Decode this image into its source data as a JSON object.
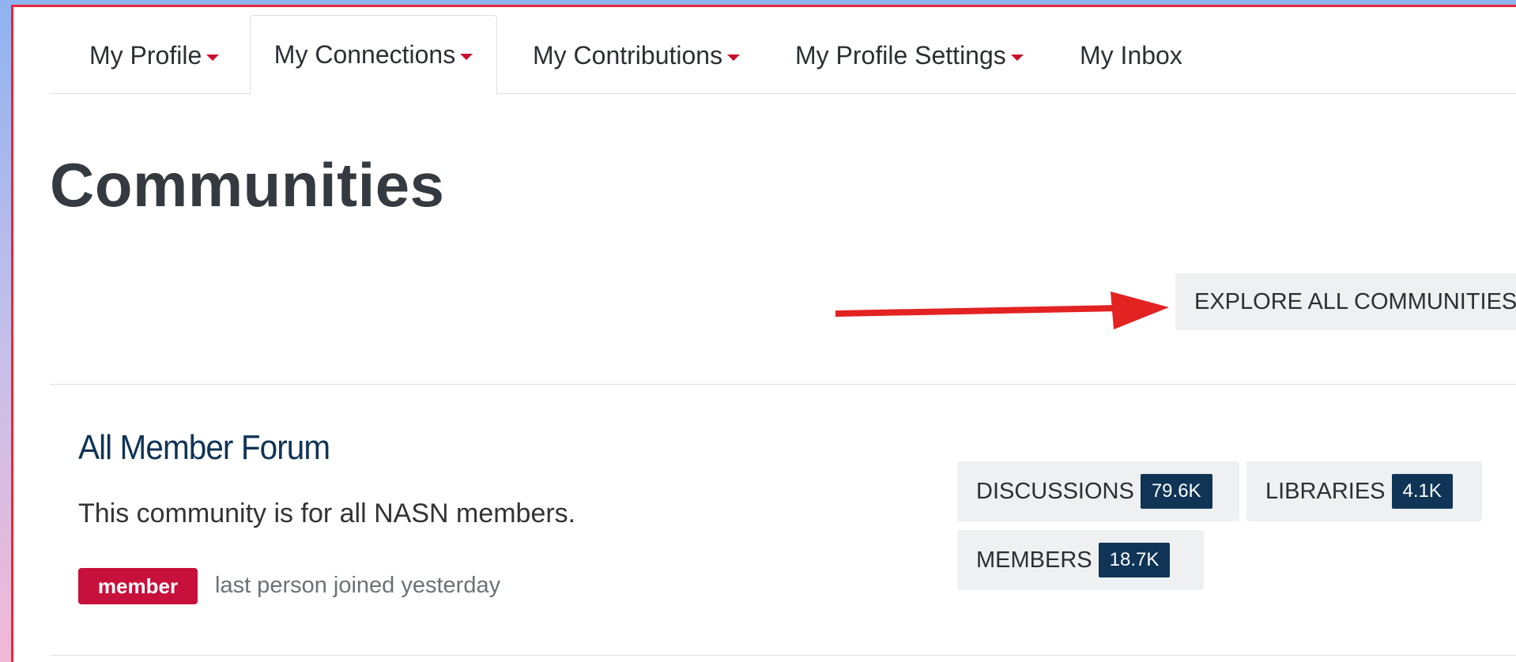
{
  "nav": {
    "tabs": [
      {
        "label": "My Profile",
        "has_caret": true
      },
      {
        "label": "My Connections",
        "has_caret": true,
        "active": true
      },
      {
        "label": "My Contributions",
        "has_caret": true
      },
      {
        "label": "My Profile Settings",
        "has_caret": true
      },
      {
        "label": "My Inbox",
        "has_caret": false
      }
    ]
  },
  "page": {
    "title": "Communities",
    "explore_button": "EXPLORE ALL COMMUNITIES"
  },
  "community": {
    "name": "All Member Forum",
    "description": "This community is for all NASN members.",
    "badge": "member",
    "joined_text": "last person joined yesterday",
    "stats": [
      {
        "label": "DISCUSSIONS",
        "count": "79.6K"
      },
      {
        "label": "LIBRARIES",
        "count": "4.1K"
      },
      {
        "label": "MEMBERS",
        "count": "18.7K"
      }
    ]
  },
  "colors": {
    "accent_red": "#c8103c",
    "navy": "#0f3456",
    "annotation_arrow": "#e32222"
  }
}
